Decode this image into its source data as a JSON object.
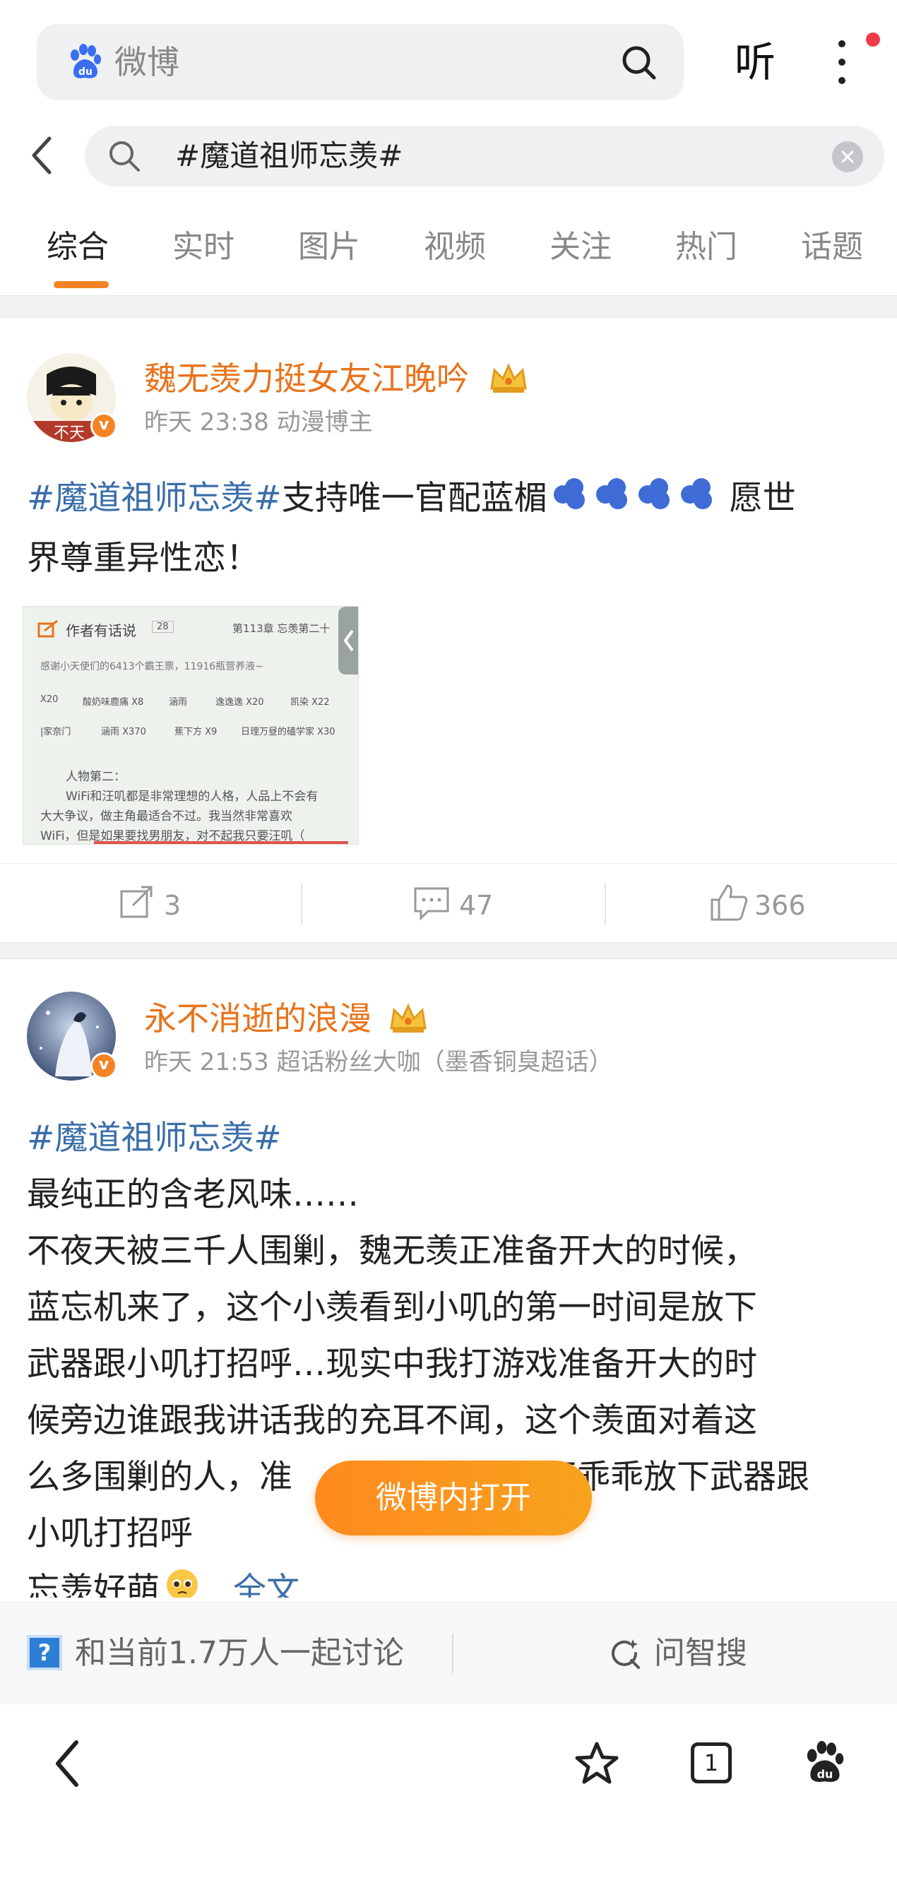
{
  "browser": {
    "search_placeholder": "微博",
    "listen_label": "听"
  },
  "weibo_search": {
    "query": "#魔道祖师忘羡#"
  },
  "tabs": [
    "综合",
    "实时",
    "图片",
    "视频",
    "关注",
    "热门",
    "话题"
  ],
  "posts": [
    {
      "username": "魏无羡力挺女友江晚吟",
      "time": "昨天 23:38",
      "tag": "动漫博主",
      "hashtag": "#魔道祖师忘羡#",
      "text_after_hashtag": "支持唯一官配蓝楣",
      "text_line2": "界尊重异性恋！",
      "text_tail": "愿世",
      "reposts": "3",
      "comments": "47",
      "likes": "366",
      "thumbnail": {
        "header": "作者有话说",
        "header_badge": "28",
        "chapter": "第113章  忘羡第二十",
        "line1": "感谢小天使们的6413个霸王票，11916瓶营养液~",
        "row1": [
          "X20",
          "酸奶味鹿痛 X8",
          "涵雨",
          "逸逸逸 X20",
          "凯染 X22"
        ],
        "row2": [
          "|家奈门",
          "涵雨 X370",
          "蕉下方 X9",
          "日理万昼的磕学家 X30"
        ],
        "p1": "人物第二：",
        "p2": "WiFi和汪叽都是非常理想的人格，人品上不会有",
        "p3": "大大争议，做主角最适合不过。我当然非常喜欢",
        "p4": "WiFi，但是如果要找男朋友，对不起我只要汪叽（"
      }
    },
    {
      "username": "永不消逝的浪漫",
      "time": "昨天 21:53",
      "tag": "超话粉丝大咖（墨香铜臭超话）",
      "hashtag": "#魔道祖师忘羡#",
      "lines": [
        "最纯正的含老风味……",
        "不夜天被三千人围剿，魏无羡正准备开大的时候，",
        "蓝忘机来了，这个小羡看到小叽的第一时间是放下",
        "武器跟小叽打招呼…现实中我打游戏准备开大的时",
        "候旁边谁跟我讲话我的充耳不闻，这个羡面对着这",
        "么多围剿的人，准",
        "小叽打招呼"
      ],
      "line6_tail": "还乖乖放下武器跟",
      "last_line": "忘羡好萌",
      "full_text_link": "全文"
    }
  ],
  "open_in_weibo_label": "微博内打开",
  "discuss_bar": {
    "text": "和当前1.7万人一起讨论",
    "ask_label": "问智搜"
  },
  "bottom_nav": {
    "tab_count": "1"
  },
  "colors": {
    "accent_orange": "#f28423",
    "hashtag_blue": "#3a6ea8",
    "username_orange": "#e8731b"
  }
}
